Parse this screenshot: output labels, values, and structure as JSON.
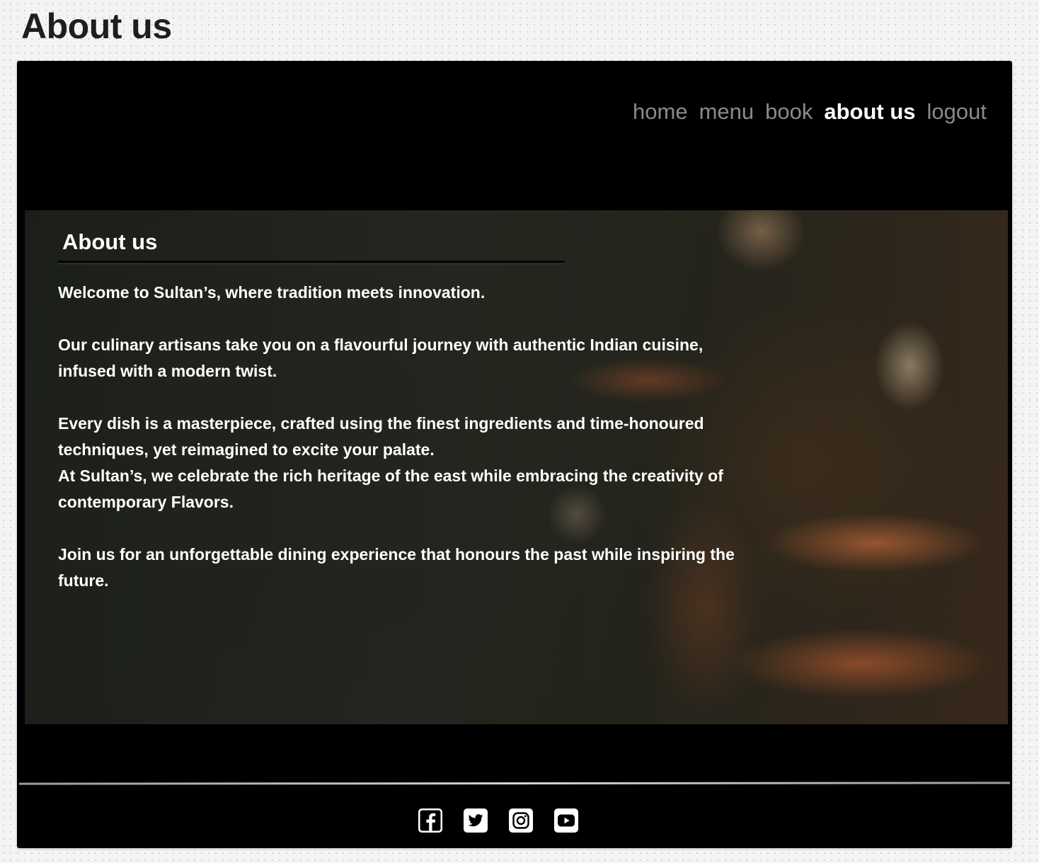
{
  "page": {
    "frame_title": "About us"
  },
  "nav": {
    "items": [
      {
        "label": "home",
        "active": false
      },
      {
        "label": "menu",
        "active": false
      },
      {
        "label": "book",
        "active": false
      },
      {
        "label": "about us",
        "active": true
      },
      {
        "label": "logout",
        "active": false
      }
    ]
  },
  "about": {
    "heading": "About us",
    "paragraphs": {
      "welcome": "Welcome to Sultan’s, where tradition meets innovation.",
      "journey_1": "Our culinary artisans take you on a flavourful journey with authentic Indian cuisine,",
      "journey_2": "infused with a modern twist.",
      "masterpiece_1": "Every dish is a masterpiece, crafted using the finest ingredients and time-honoured",
      "masterpiece_2": "techniques, yet reimagined to excite your palate.",
      "heritage_1": "At Sultan’s, we celebrate the rich heritage of the east while embracing the creativity of",
      "heritage_2": "contemporary Flavors.",
      "join_1": "Join us for an unforgettable dining experience that honours the past while inspiring the",
      "join_2": "future."
    }
  },
  "footer": {
    "social_icons": [
      "facebook-icon",
      "twitter-icon",
      "instagram-icon",
      "youtube-icon"
    ]
  },
  "colors": {
    "page_bg": "#f4f4f4",
    "frame_bg": "#000000",
    "nav_inactive": "#8a8a8a",
    "nav_active": "#ffffff",
    "text": "#ffffff"
  }
}
